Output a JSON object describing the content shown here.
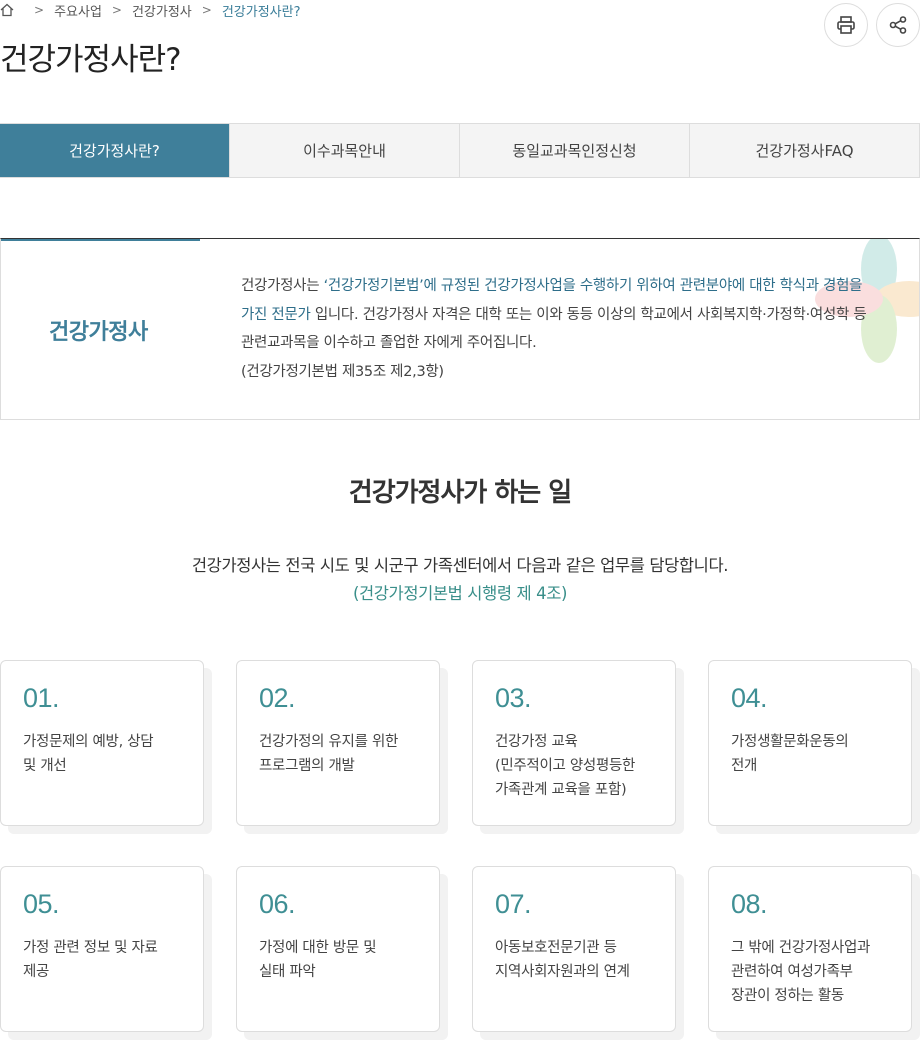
{
  "breadcrumb": {
    "home_icon": "home-icon",
    "items": [
      "주요사업",
      "건강가정사",
      "건강가정사란?"
    ]
  },
  "page_title": "건강가정사란?",
  "tools": {
    "print_icon": "print-icon",
    "share_icon": "share-icon"
  },
  "tabs": [
    {
      "label": "건강가정사란?",
      "active": true
    },
    {
      "label": "이수과목안내",
      "active": false
    },
    {
      "label": "동일교과목인정신청",
      "active": false
    },
    {
      "label": "건강가정사FAQ",
      "active": false
    }
  ],
  "definition": {
    "term": "건강가정사",
    "desc_part1": "건강가정사는 ",
    "desc_hl1": "‘건강가정기본법’에 규정된 건강가정사업을 수행하기 위하여 관련분야에 대한 학식과 경험을 가진 전문가",
    "desc_part2": " 입니다. 건강가정사 자격은 대학 또는 이와 동등 이상의 학교에서 사회복지학·가정학·여성학 등 관련교과목을 이수하고 졸업한 자에게 주어집니다.",
    "ref": "(건강가정기본법 제35조 제2,3항)"
  },
  "section": {
    "title": "건강가정사가 하는 일",
    "intro": "건강가정사는 전국 시도 및 시군구 가족센터에서 다음과 같은 업무를 담당합니다.",
    "intro_ref": "(건강가정기본법 시행령 제 4조)"
  },
  "cards": [
    {
      "num": "01.",
      "text": "가정문제의 예방, 상담\n및 개선"
    },
    {
      "num": "02.",
      "text": "건강가정의 유지를 위한\n프로그램의 개발"
    },
    {
      "num": "03.",
      "text": "건강가정 교육\n(민주적이고 양성평등한\n가족관계 교육을 포함)"
    },
    {
      "num": "04.",
      "text": "가정생활문화운동의\n전개"
    },
    {
      "num": "05.",
      "text": "가정 관련 정보 및 자료\n제공"
    },
    {
      "num": "06.",
      "text": "가정에 대한 방문 및\n실태 파악"
    },
    {
      "num": "07.",
      "text": "아동보호전문기관 등\n지역사회자원과의 연계"
    },
    {
      "num": "08.",
      "text": "그 밖에 건강가정사업과\n관련하여 여성가족부\n장관이 정하는 활동"
    }
  ],
  "colors": {
    "accent": "#3f7f9a",
    "number": "#3f8f94",
    "highlight_bg": "#d8eaec"
  }
}
